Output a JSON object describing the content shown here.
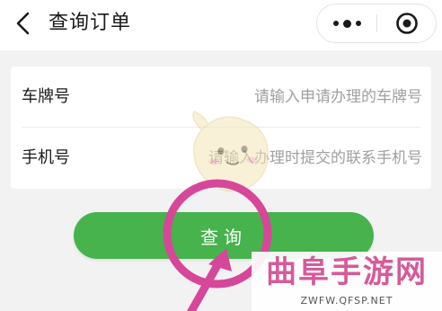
{
  "nav": {
    "title": "查询订单",
    "back_icon": "chevron-left-icon",
    "more_icon": "more-dots-icon",
    "close_icon": "target-close-icon"
  },
  "form": {
    "plate": {
      "label": "车牌号",
      "placeholder": "请输入申请办理的车牌号",
      "value": ""
    },
    "phone": {
      "label": "手机号",
      "placeholder": "请输入办理时提交的联系手机号",
      "value": ""
    }
  },
  "query_button": {
    "label": "查询",
    "color": "#47b34c"
  },
  "watermark": {
    "site_name": "曲阜手游网",
    "site_url": "ZWFW.QFSP.NET",
    "accent_color": "#d65a9b"
  }
}
